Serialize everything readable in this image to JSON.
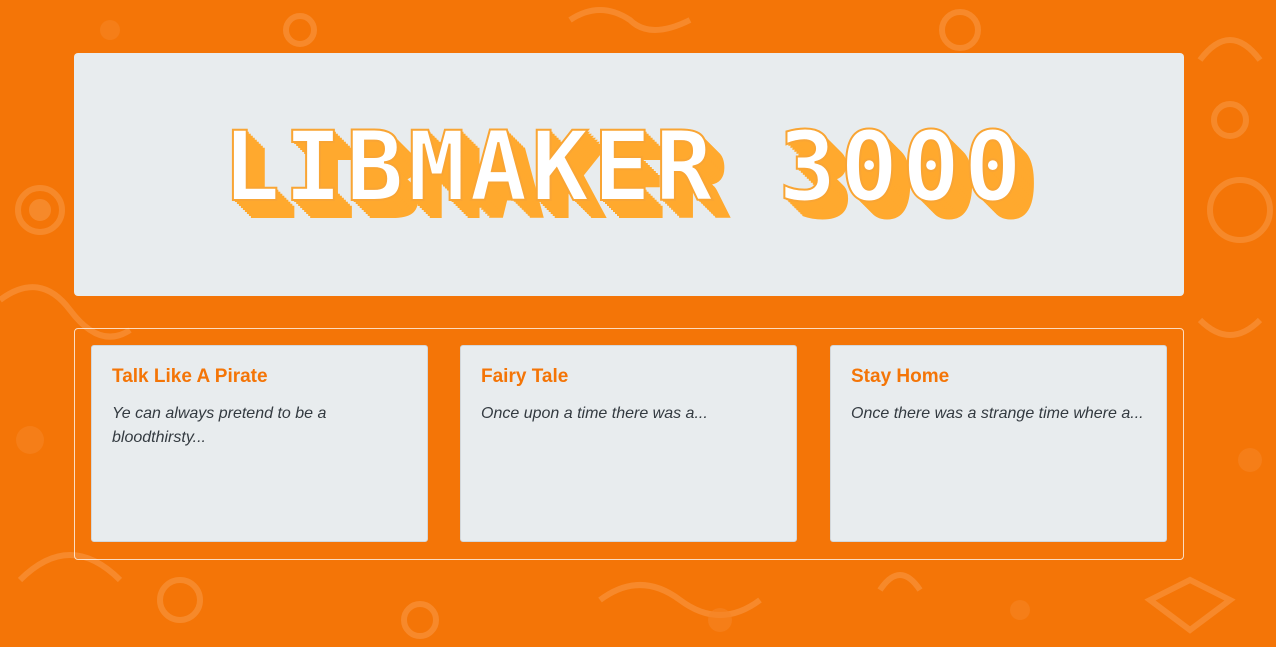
{
  "header": {
    "logo_text": "LIBMAKER 3000"
  },
  "stories": [
    {
      "title": "Talk Like A Pirate",
      "excerpt": "Ye can always pretend to be a bloodthirsty..."
    },
    {
      "title": "Fairy Tale",
      "excerpt": "Once upon a time there was a..."
    },
    {
      "title": "Stay Home",
      "excerpt": "Once there was a strange time where a..."
    }
  ],
  "colors": {
    "background": "#f47507",
    "card": "#e8ecee",
    "accent": "#f47507",
    "logo_shadow": "#ffa92e"
  }
}
